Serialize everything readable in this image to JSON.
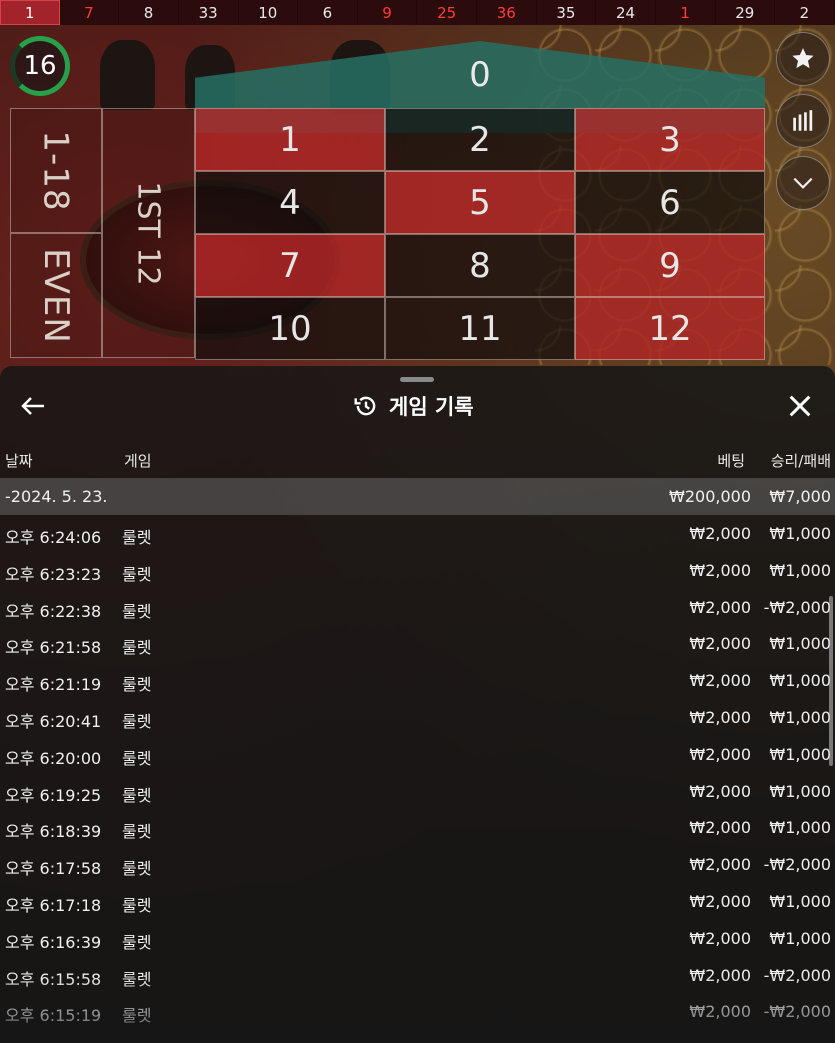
{
  "result_strip": [
    {
      "value": "1",
      "color": "red",
      "latest": true
    },
    {
      "value": "7",
      "color": "red"
    },
    {
      "value": "8",
      "color": "black"
    },
    {
      "value": "33",
      "color": "black"
    },
    {
      "value": "10",
      "color": "black"
    },
    {
      "value": "6",
      "color": "black"
    },
    {
      "value": "9",
      "color": "red"
    },
    {
      "value": "25",
      "color": "red"
    },
    {
      "value": "36",
      "color": "red"
    },
    {
      "value": "35",
      "color": "black"
    },
    {
      "value": "24",
      "color": "black"
    },
    {
      "value": "1",
      "color": "red"
    },
    {
      "value": "29",
      "color": "black"
    },
    {
      "value": "2",
      "color": "black"
    }
  ],
  "timer": {
    "value": "16"
  },
  "board": {
    "zero": "0",
    "numbers": [
      {
        "n": "1",
        "c": "red"
      },
      {
        "n": "2",
        "c": "black"
      },
      {
        "n": "3",
        "c": "red"
      },
      {
        "n": "4",
        "c": "black"
      },
      {
        "n": "5",
        "c": "red"
      },
      {
        "n": "6",
        "c": "black"
      },
      {
        "n": "7",
        "c": "red"
      },
      {
        "n": "8",
        "c": "black"
      },
      {
        "n": "9",
        "c": "red"
      },
      {
        "n": "10",
        "c": "black"
      },
      {
        "n": "11",
        "c": "black"
      },
      {
        "n": "12",
        "c": "red"
      }
    ],
    "low_label": "1-18",
    "even_label": "EVEN",
    "dozen_label": "1ST 12"
  },
  "side_buttons": [
    {
      "name": "favorite",
      "icon": "star-icon"
    },
    {
      "name": "statistics",
      "icon": "stats-bars-icon"
    },
    {
      "name": "collapse",
      "icon": "chevron-down-icon"
    }
  ],
  "panel": {
    "title": "게임 기록",
    "columns": {
      "date": "날짜",
      "game": "게임",
      "bet": "베팅",
      "win": "승리/패배"
    },
    "summary": {
      "date": "-2024. 5. 23.",
      "bet": "₩200,000",
      "win": "₩7,000"
    },
    "rows": [
      {
        "time": "오후 6:24:06",
        "game": "룰렛",
        "bet": "₩2,000",
        "win": "₩1,000"
      },
      {
        "time": "오후 6:23:23",
        "game": "룰렛",
        "bet": "₩2,000",
        "win": "₩1,000"
      },
      {
        "time": "오후 6:22:38",
        "game": "룰렛",
        "bet": "₩2,000",
        "win": "-₩2,000"
      },
      {
        "time": "오후 6:21:58",
        "game": "룰렛",
        "bet": "₩2,000",
        "win": "₩1,000"
      },
      {
        "time": "오후 6:21:19",
        "game": "룰렛",
        "bet": "₩2,000",
        "win": "₩1,000"
      },
      {
        "time": "오후 6:20:41",
        "game": "룰렛",
        "bet": "₩2,000",
        "win": "₩1,000"
      },
      {
        "time": "오후 6:20:00",
        "game": "룰렛",
        "bet": "₩2,000",
        "win": "₩1,000"
      },
      {
        "time": "오후 6:19:25",
        "game": "룰렛",
        "bet": "₩2,000",
        "win": "₩1,000"
      },
      {
        "time": "오후 6:18:39",
        "game": "룰렛",
        "bet": "₩2,000",
        "win": "₩1,000"
      },
      {
        "time": "오후 6:17:58",
        "game": "룰렛",
        "bet": "₩2,000",
        "win": "-₩2,000"
      },
      {
        "time": "오후 6:17:18",
        "game": "룰렛",
        "bet": "₩2,000",
        "win": "₩1,000"
      },
      {
        "time": "오후 6:16:39",
        "game": "룰렛",
        "bet": "₩2,000",
        "win": "₩1,000"
      },
      {
        "time": "오후 6:15:58",
        "game": "룰렛",
        "bet": "₩2,000",
        "win": "-₩2,000"
      },
      {
        "time": "오후 6:15:19",
        "game": "룰렛",
        "bet": "₩2,000",
        "win": "-₩2,000"
      }
    ]
  }
}
